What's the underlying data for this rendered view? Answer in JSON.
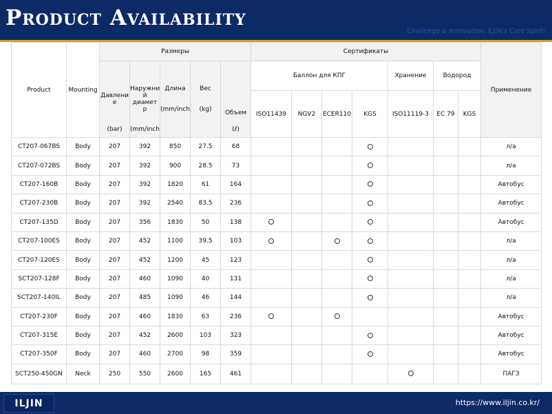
{
  "header": {
    "title": "Product Availability",
    "tagline": "Challenge & Innovation, ILJIN's Core Spirit!"
  },
  "footer": {
    "logo": "ILJIN",
    "url": "https://www.iljin.co.kr/"
  },
  "table": {
    "headers": {
      "product": "Product",
      "mounting": "Mounting",
      "dimensions": "Размеры",
      "certificates": "Сертификаты",
      "application": "Применение",
      "cng_cylinder": "Баллон для КПГ",
      "storage": "Хранение",
      "hydrogen": "Водород",
      "pressure": "Давлени е",
      "pressure_unit": "(bar)",
      "outer_diameter": "Наружни й диамет р",
      "outer_diameter_unit": "(mm/inch)",
      "length": "Длина",
      "length_unit": "(mm/inch)",
      "weight": "Вес",
      "weight_unit": "(kg)",
      "volume": "Объем",
      "volume_unit": "(ℓ)",
      "cert_iso11439": "ISO11439",
      "cert_ngv2": "NGV2",
      "cert_ecer110": "ECER110",
      "cert_kgs": "KGS",
      "cert_iso11119_3": "ISO11119-3",
      "cert_ec79": "EC 79",
      "cert_kgs_h2": "KGS"
    },
    "rows": [
      {
        "product": "CT207-067BS",
        "mounting": "Body",
        "pressure": "207",
        "diameter": "392",
        "length": "850",
        "weight": "27.5",
        "volume": "68",
        "certs": [
          false,
          false,
          false,
          true,
          false,
          false,
          false
        ],
        "application": "л/а"
      },
      {
        "product": "CT207-072BS",
        "mounting": "Body",
        "pressure": "207",
        "diameter": "392",
        "length": "900",
        "weight": "28.5",
        "volume": "73",
        "certs": [
          false,
          false,
          false,
          true,
          false,
          false,
          false
        ],
        "application": "л/а"
      },
      {
        "product": "CT207-160B",
        "mounting": "Body",
        "pressure": "207",
        "diameter": "392",
        "length": "1820",
        "weight": "61",
        "volume": "164",
        "certs": [
          false,
          false,
          false,
          true,
          false,
          false,
          false
        ],
        "application": "Автобус"
      },
      {
        "product": "CT207-230B",
        "mounting": "Body",
        "pressure": "207",
        "diameter": "392",
        "length": "2540",
        "weight": "83.5",
        "volume": "236",
        "certs": [
          false,
          false,
          false,
          true,
          false,
          false,
          false
        ],
        "application": "Автобус"
      },
      {
        "product": "CT207-135D",
        "mounting": "Body",
        "pressure": "207",
        "diameter": "356",
        "length": "1830",
        "weight": "50",
        "volume": "138",
        "certs": [
          true,
          false,
          false,
          true,
          false,
          false,
          false
        ],
        "application": "Автобус"
      },
      {
        "product": "CT207-100ES",
        "mounting": "Body",
        "pressure": "207",
        "diameter": "452",
        "length": "1100",
        "weight": "39.5",
        "volume": "103",
        "certs": [
          true,
          false,
          true,
          true,
          false,
          false,
          false
        ],
        "application": "л/а"
      },
      {
        "product": "CT207-120ES",
        "mounting": "Body",
        "pressure": "207",
        "diameter": "452",
        "length": "1200",
        "weight": "45",
        "volume": "123",
        "certs": [
          false,
          false,
          false,
          true,
          false,
          false,
          false
        ],
        "application": "л/а"
      },
      {
        "product": "SCT207-128F",
        "mounting": "Body",
        "pressure": "207",
        "diameter": "460",
        "length": "1090",
        "weight": "40",
        "volume": "131",
        "certs": [
          false,
          false,
          false,
          true,
          false,
          false,
          false
        ],
        "application": "л/а"
      },
      {
        "product": "SCT207-140IL",
        "mounting": "Body",
        "pressure": "207",
        "diameter": "485",
        "length": "1090",
        "weight": "46",
        "volume": "144",
        "certs": [
          false,
          false,
          false,
          true,
          false,
          false,
          false
        ],
        "application": "л/а"
      },
      {
        "product": "CT207-230F",
        "mounting": "Body",
        "pressure": "207",
        "diameter": "460",
        "length": "1830",
        "weight": "63",
        "volume": "236",
        "certs": [
          true,
          false,
          true,
          false,
          false,
          false,
          false
        ],
        "application": "Автобус"
      },
      {
        "product": "CT207-315E",
        "mounting": "Body",
        "pressure": "207",
        "diameter": "452",
        "length": "2600",
        "weight": "103",
        "volume": "323",
        "certs": [
          false,
          false,
          false,
          true,
          false,
          false,
          false
        ],
        "application": "Автобус"
      },
      {
        "product": "CT207-350F",
        "mounting": "Body",
        "pressure": "207",
        "diameter": "460",
        "length": "2700",
        "weight": "98",
        "volume": "359",
        "certs": [
          false,
          false,
          false,
          true,
          false,
          false,
          false
        ],
        "application": "Автобус"
      },
      {
        "product": "SCT250-450GN",
        "mounting": "Neck",
        "pressure": "250",
        "diameter": "550",
        "length": "2600",
        "weight": "165",
        "volume": "461",
        "certs": [
          false,
          false,
          false,
          false,
          true,
          false,
          false
        ],
        "application": "ПАГЗ"
      }
    ]
  }
}
